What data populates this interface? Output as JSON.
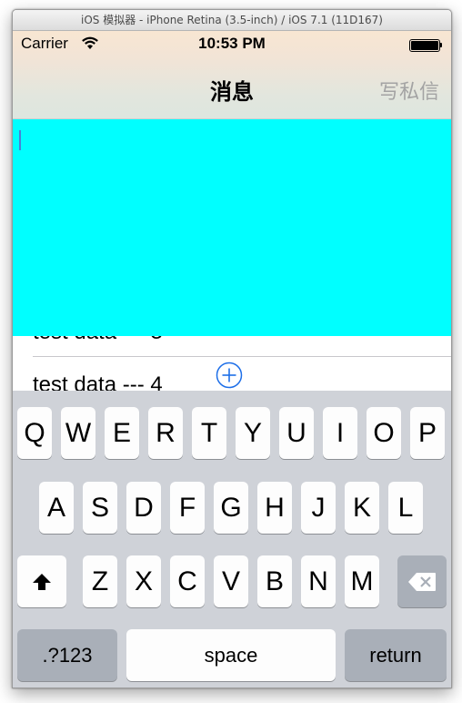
{
  "window": {
    "title": "iOS 模拟器 - iPhone Retina (3.5-inch) / iOS 7.1 (11D167)"
  },
  "status_bar": {
    "carrier": "Carrier",
    "time": "10:53 PM",
    "icons": [
      "wifi-icon",
      "battery-icon"
    ]
  },
  "nav": {
    "title": "消息",
    "right_button": "写私信"
  },
  "text_view": {
    "background": "#00ffff",
    "value": ""
  },
  "table": {
    "rows": [
      {
        "label": "test data --- 4"
      }
    ],
    "accessory_icon": "plus-circle-icon",
    "accent": "#1e6fe8"
  },
  "keyboard": {
    "row1": [
      "Q",
      "W",
      "E",
      "R",
      "T",
      "Y",
      "U",
      "I",
      "O",
      "P"
    ],
    "row2": [
      "A",
      "S",
      "D",
      "F",
      "G",
      "H",
      "J",
      "K",
      "L"
    ],
    "row3": [
      "Z",
      "X",
      "C",
      "V",
      "B",
      "N",
      "M"
    ],
    "numbers_label": ".?123",
    "space_label": "space",
    "return_label": "return",
    "shift_icon": "shift-icon",
    "delete_icon": "delete-icon"
  }
}
